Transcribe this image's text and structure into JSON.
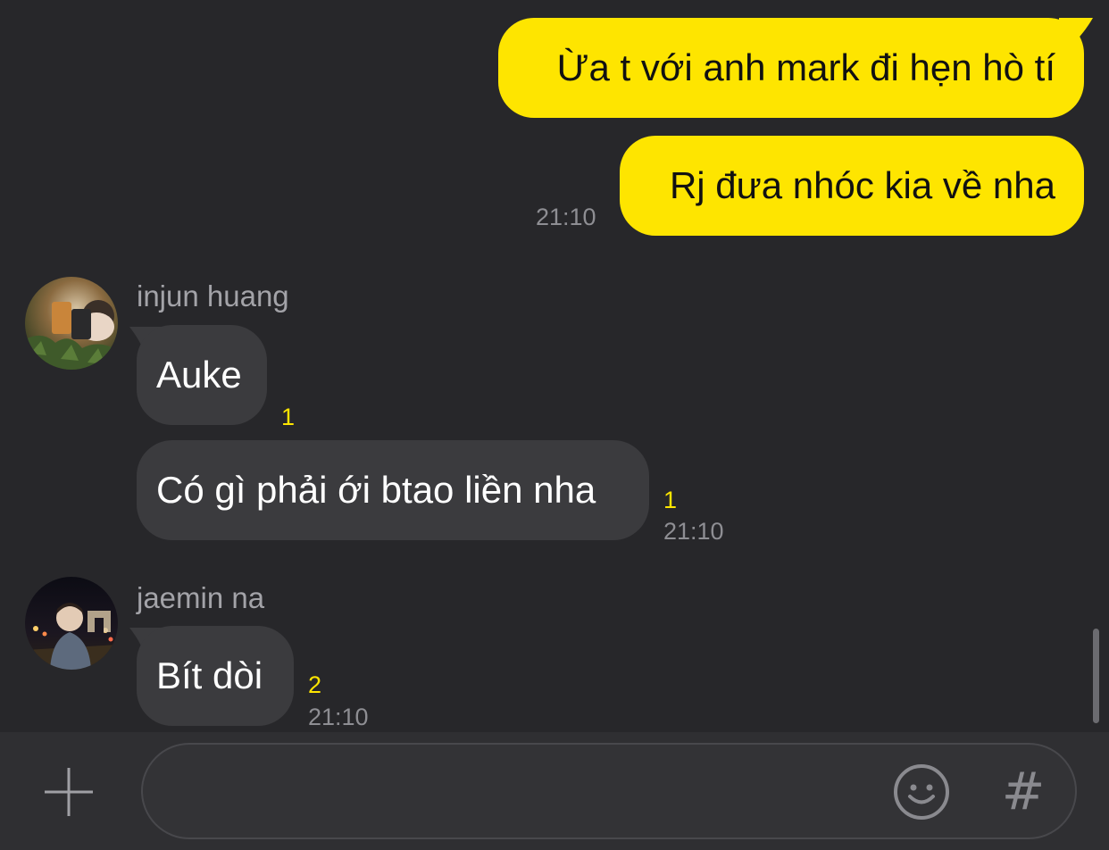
{
  "messages": {
    "me": [
      {
        "text": "Ừa t với anh mark đi hẹn hò tí"
      },
      {
        "text": "Rj đưa nhóc kia về nha",
        "time": "21:10"
      }
    ],
    "injun": {
      "sender": "injun huang",
      "bubbles": [
        {
          "text": "Auke",
          "unread": "1"
        },
        {
          "text": "Có gì phải ới btao liền nha",
          "unread": "1",
          "time": "21:10"
        }
      ]
    },
    "jaemin": {
      "sender": "jaemin na",
      "bubbles": [
        {
          "text": "Bít dòi",
          "unread": "2",
          "time": "21:10"
        }
      ]
    }
  },
  "input": {
    "value": "",
    "placeholder": ""
  },
  "icons": {
    "attach": "plus-icon",
    "emoji": "smiley-icon",
    "hashtag": "hash-icon"
  },
  "colors": {
    "background": "#27272a",
    "my_bubble": "#fee500",
    "their_bubble": "#3b3b3e",
    "unread": "#fee500",
    "input_bar": "#2f2f32"
  }
}
